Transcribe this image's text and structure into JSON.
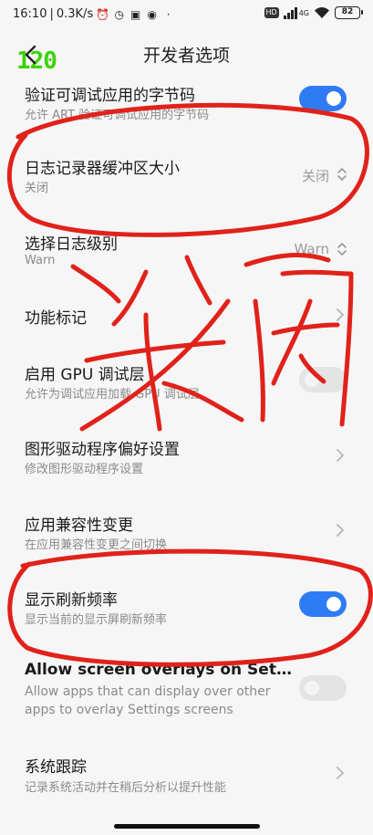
{
  "status_bar": {
    "time": "16:10",
    "speed": "0.3K/s",
    "network": "4G",
    "battery": "82"
  },
  "fps": "120",
  "header": {
    "title": "开发者选项"
  },
  "rows": [
    {
      "title": "验证可调试应用的字节码",
      "sub": "允许 ART 验证可调试应用的字节码",
      "control": "toggle",
      "state": true
    },
    {
      "title": "日志记录器缓冲区大小",
      "sub": "关闭",
      "control": "select",
      "value": "关闭"
    },
    {
      "title": "选择日志级别",
      "sub": "Warn",
      "control": "select",
      "value": "Warn"
    },
    {
      "title": "功能标记",
      "sub": "",
      "control": "chevron"
    },
    {
      "title": "启用 GPU 调试层",
      "sub": "允许为调试应用加载 GPU 调试层",
      "control": "toggle",
      "state": false
    },
    {
      "title": "图形驱动程序偏好设置",
      "sub": "修改图形驱动程序设置",
      "control": "chevron"
    },
    {
      "title": "应用兼容性变更",
      "sub": "在应用兼容性变更之间切换",
      "control": "chevron"
    },
    {
      "title": "显示刷新频率",
      "sub": "显示当前的显示屏刷新频率",
      "control": "toggle",
      "state": true
    },
    {
      "title": "Allow screen overlays on Set…",
      "sub": "Allow apps that can display over other",
      "sub2": "apps to overlay Settings screens",
      "control": "toggle",
      "state": false
    },
    {
      "title": "系统跟踪",
      "sub": "记录系统活动并在稍后分析以提升性能",
      "control": "chevron"
    }
  ],
  "annotation": {
    "text": "关闭",
    "color": "#e0221b"
  }
}
